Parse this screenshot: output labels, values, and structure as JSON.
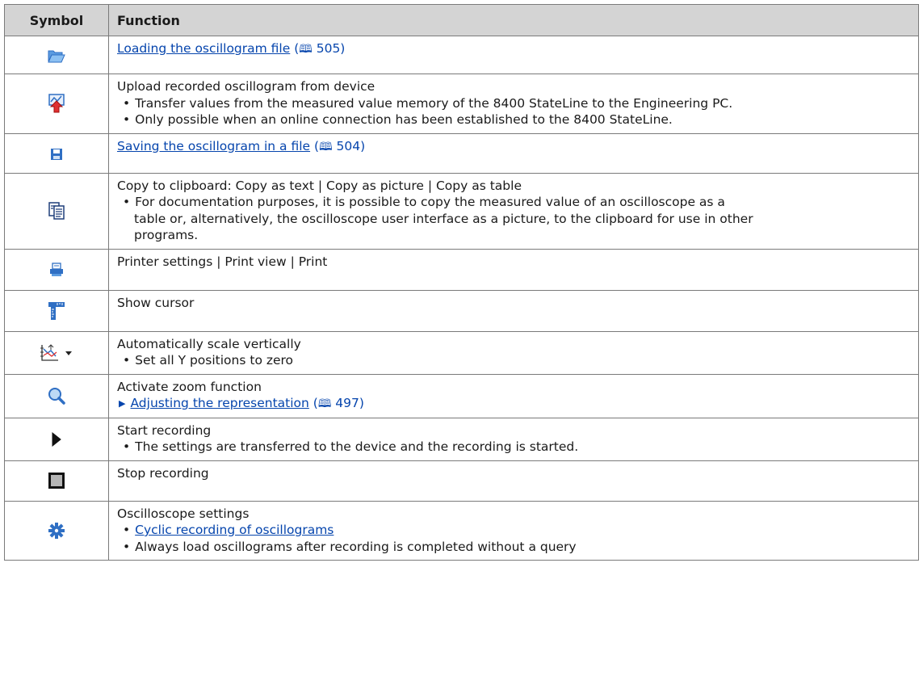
{
  "header": {
    "symbol": "Symbol",
    "function": "Function"
  },
  "rows": [
    {
      "icon": "open-folder-icon",
      "link": "Loading the oscillogram file",
      "ref_open": "(",
      "ref_book": "🕮",
      "ref_page": " 505)"
    },
    {
      "icon": "upload-oscillogram-icon",
      "title": "Upload recorded oscillogram from device",
      "bullets": [
        "Transfer values from the measured value memory of the 8400 StateLine to the Engineering PC.",
        "Only possible when an online connection has been established to the 8400 StateLine."
      ]
    },
    {
      "icon": "save-disk-icon",
      "link": "Saving the oscillogram in a file",
      "ref_open": "(",
      "ref_book": "🕮",
      "ref_page": " 504)"
    },
    {
      "icon": "copy-clipboard-icon",
      "title": "Copy to clipboard: Copy as text | Copy as picture | Copy as table",
      "bullet": "For documentation purposes, it is possible to copy the measured value of an oscilloscope as a",
      "bullet_cont": [
        "table or, alternatively, the oscilloscope user interface as a picture, to the clipboard for use in other",
        "programs."
      ]
    },
    {
      "icon": "printer-icon",
      "title": "Printer settings | Print view | Print"
    },
    {
      "icon": "cursor-ruler-icon",
      "title": "Show cursor"
    },
    {
      "icon": "auto-scale-icon",
      "dropdown_icon": "dropdown-arrow-icon",
      "title": "Automatically scale vertically",
      "bullets": [
        "Set all Y positions to zero"
      ]
    },
    {
      "icon": "zoom-magnifier-icon",
      "title": "Activate zoom function",
      "link": "Adjusting the representation",
      "ref_open": "(",
      "ref_book": "🕮",
      "ref_page": " 497)"
    },
    {
      "icon": "start-recording-icon",
      "title": "Start recording",
      "bullets": [
        "The settings are transferred to the device and the recording is started."
      ]
    },
    {
      "icon": "stop-recording-icon",
      "title": "Stop recording"
    },
    {
      "icon": "settings-gear-icon",
      "title": "Oscilloscope settings",
      "bullet_link": "Cyclic recording of oscillograms",
      "bullets": [
        "Always load oscillograms after recording is completed without a query"
      ]
    }
  ],
  "colors": {
    "header_bg": "#d4d4d4",
    "border": "#7a7a7a",
    "link": "#0645ad",
    "icon_blue": "#2f6fc4"
  }
}
